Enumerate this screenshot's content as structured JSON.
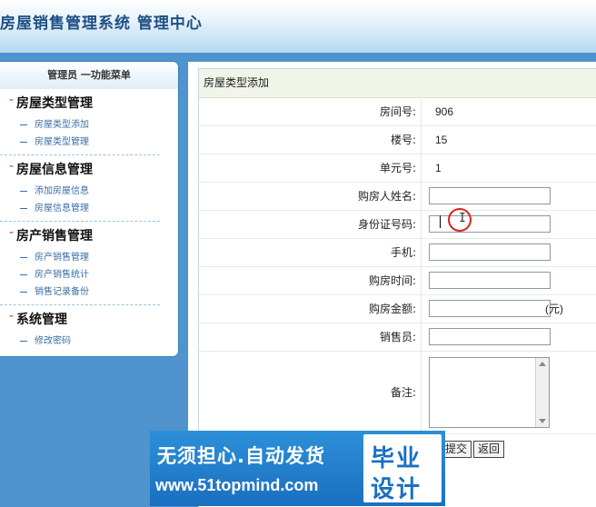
{
  "app": {
    "title": "房屋销售管理系统  管理中心"
  },
  "sidebar": {
    "header": "管理员  一功能菜单",
    "groups": [
      {
        "title": "房屋类型管理",
        "items": [
          "房屋类型添加",
          "房屋类型管理"
        ]
      },
      {
        "title": "房屋信息管理",
        "items": [
          "添加房屋信息",
          "房屋信息管理"
        ]
      },
      {
        "title": "房产销售管理",
        "items": [
          "房产销售管理",
          "房产销售统计",
          "销售记录备份"
        ]
      },
      {
        "title": "系统管理",
        "items": [
          "修改密码"
        ]
      }
    ]
  },
  "form": {
    "heading": "房屋类型添加",
    "room_no": {
      "label": "房间号:",
      "value": "906"
    },
    "building": {
      "label": "楼号:",
      "value": "15"
    },
    "unit_no": {
      "label": "单元号:",
      "value": "1"
    },
    "buyer_name": {
      "label": "购房人姓名:",
      "value": ""
    },
    "id_number": {
      "label": "身份证号码:",
      "value": ""
    },
    "phone": {
      "label": "手机:",
      "value": ""
    },
    "buy_time": {
      "label": "购房时间:",
      "value": ""
    },
    "amount": {
      "label": "购房金额:",
      "value": "",
      "unit": "(元)"
    },
    "salesperson": {
      "label": "销售员:",
      "value": ""
    },
    "notes": {
      "label": "备注:"
    },
    "submit_label": "提交",
    "back_label": "返回"
  },
  "watermark": {
    "line1": "无须担心.自动发货",
    "line2": "www.51topmind.com",
    "badge1": "毕业",
    "badge2": "设计"
  },
  "colors": {
    "header_text": "#1f4f82",
    "frame_blue": "#4f93cf",
    "cursor_ring": "#d9241c"
  },
  "icons": [
    "ibeam-cursor-icon",
    "scroll-up-icon",
    "scroll-down-icon"
  ]
}
